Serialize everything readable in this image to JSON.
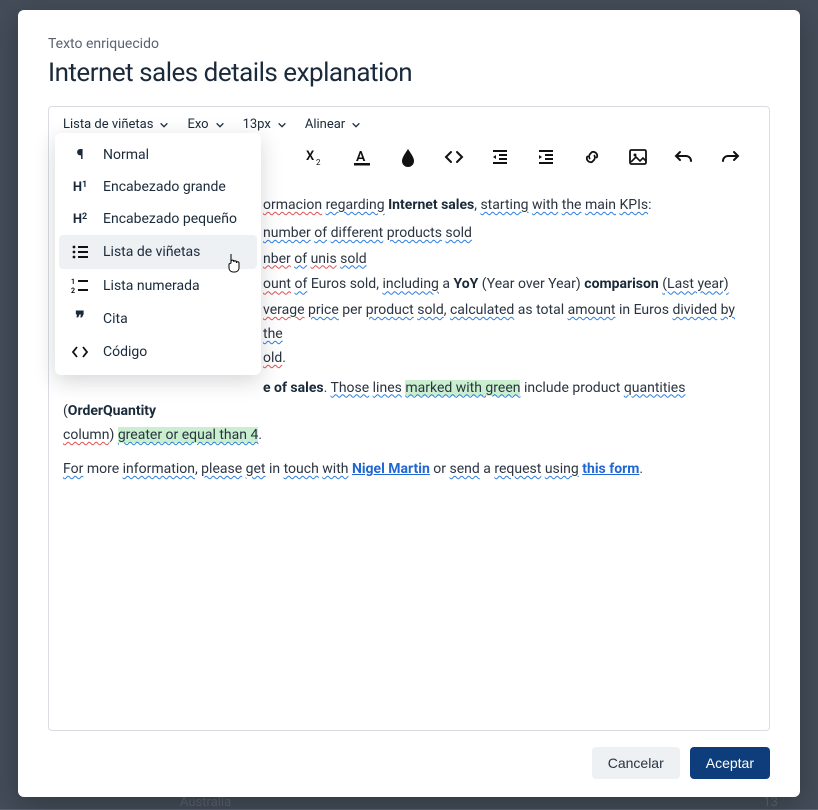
{
  "modal": {
    "subtitle": "Texto enriquecido",
    "title": "Internet sales details explanation"
  },
  "toolbar": {
    "block_style": "Lista de viñetas",
    "font": "Exo",
    "size": "13px",
    "align": "Alinear"
  },
  "dropdown": {
    "items": [
      {
        "icon": "pilcrow",
        "label": "Normal"
      },
      {
        "icon": "h1",
        "label": "Encabezado grande"
      },
      {
        "icon": "h2",
        "label": "Encabezado pequeño"
      },
      {
        "icon": "ul",
        "label": "Lista de viñetas"
      },
      {
        "icon": "ol",
        "label": "Lista numerada"
      },
      {
        "icon": "quote",
        "label": "Cita"
      },
      {
        "icon": "code",
        "label": "Código"
      }
    ],
    "hover_index": 3
  },
  "content": {
    "intro_pre": "ormacion",
    "intro_regarding": "regarding",
    "intro_internet_sales": "Internet sales",
    "intro_starting": "starting",
    "intro_with": "with",
    "intro_the": "the",
    "intro_main": "main",
    "intro_kpis": "KPIs",
    "b1_number": "number",
    "b1_of": "of",
    "b1_different": "different",
    "b1_products": "products",
    "b1_sold": "sold",
    "b2_nber": "nber",
    "b2_of": "of",
    "b2_unis": "unis",
    "b2_sold": "sold",
    "b3_ount": "ount",
    "b3_of": "of",
    "b3_euros_sold": "Euros sold",
    "b3_including": "including",
    "b3_a": "a",
    "b3_yoy": "YoY",
    "b3_year_over_year": "(Year over Year)",
    "b3_comparison": "comparison",
    "b3_last_year": "(Last year)",
    "b4_verage": "verage",
    "b4_price": "price",
    "b4_per": "per",
    "b4_product": "product",
    "b4_sold": "sold",
    "b4_calculated": "calculated",
    "b4_as_total": "as total",
    "b4_amount": "amount",
    "b4_in_euros": "in Euros",
    "b4_divided": "divided",
    "b4_by": "by",
    "b4_the": "the",
    "b4_old": "old",
    "p2_e_of_sales": "e of sales",
    "p2_those": "Those",
    "p2_lines": "lines",
    "p2_marked_with_green": "marked with green",
    "p2_include_product": "include product",
    "p2_quantities": "quantities",
    "p2_orderquantity": "OrderQuantity",
    "p2_column": "column",
    "p2_greater": "greater or equal than 4",
    "p3_for": "For",
    "p3_more": "more",
    "p3_information": "information",
    "p3_please": "please",
    "p3_get": "get",
    "p3_in": "in",
    "p3_touch": "touch",
    "p3_with": "with",
    "p3_nigel": "Nigel Martin",
    "p3_or": "or",
    "p3_send": "send",
    "p3_a": "a",
    "p3_request": "request",
    "p3_using": "using",
    "p3_this_form": "this form"
  },
  "footer": {
    "cancel": "Cancelar",
    "accept": "Aceptar"
  },
  "background": {
    "row_label": "Australia",
    "row_value": "13"
  }
}
